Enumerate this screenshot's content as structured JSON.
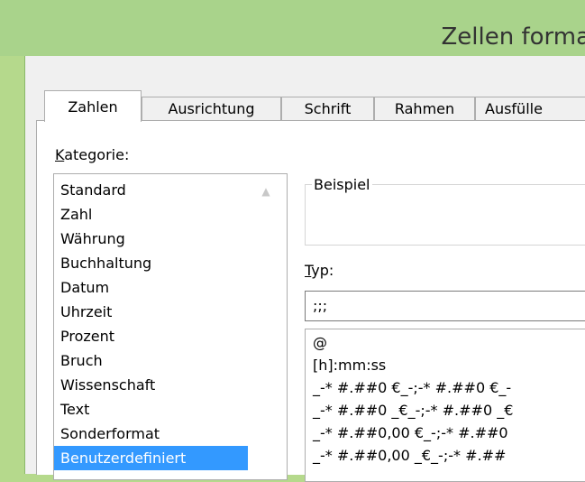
{
  "window": {
    "title": "Zellen forma"
  },
  "tabs": [
    {
      "label": "Zahlen",
      "active": true
    },
    {
      "label": "Ausrichtung",
      "active": false
    },
    {
      "label": "Schrift",
      "active": false
    },
    {
      "label": "Rahmen",
      "active": false
    },
    {
      "label": "Ausfülle",
      "active": false
    }
  ],
  "kategorie": {
    "label_first": "K",
    "label_rest": "ategorie:",
    "items": [
      "Standard",
      "Zahl",
      "Währung",
      "Buchhaltung",
      "Datum",
      "Uhrzeit",
      "Prozent",
      "Bruch",
      "Wissenschaft",
      "Text",
      "Sonderformat",
      "Benutzerdefiniert"
    ],
    "selected": "Benutzerdefiniert"
  },
  "beispiel": {
    "label": "Beispiel"
  },
  "typ": {
    "label_first": "T",
    "label_rest": "yp:",
    "value": ";;;"
  },
  "formats": [
    "@",
    "[h]:mm:ss",
    "_-* #.##0 €_-;-* #.##0 €_-",
    "_-* #.##0 _€_-;-* #.##0 _€",
    "_-* #.##0,00 €_-;-* #.##0",
    "_-* #.##0,00 _€_-;-* #.##"
  ]
}
